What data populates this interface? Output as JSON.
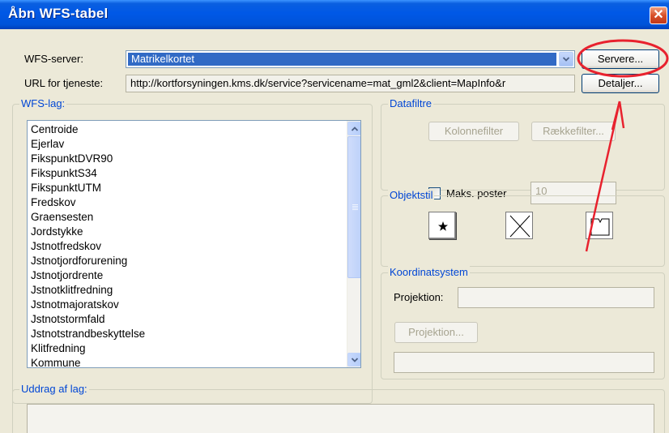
{
  "window": {
    "title": "Åbn WFS-tabel",
    "close_glyph": "✕"
  },
  "server": {
    "label": "WFS-server:",
    "selected": "Matrikelkortet",
    "servers_button": "Servere..."
  },
  "url": {
    "label": "URL for tjeneste:",
    "value": "http://kortforsyningen.kms.dk/service?servicename=mat_gml2&client=MapInfo&r",
    "details_button": "Detaljer..."
  },
  "layers": {
    "legend": "WFS-lag:",
    "items": [
      "Centroide",
      "Ejerlav",
      "FikspunktDVR90",
      "FikspunktS34",
      "FikspunktUTM",
      "Fredskov",
      "Graensesten",
      "Jordstykke",
      "Jstnotfredskov",
      "Jstnotjordforurening",
      "Jstnotjordrente",
      "Jstnotklitfredning",
      "Jstnotmajoratskov",
      "Jstnotstormfald",
      "Jstnotstrandbeskyttelse",
      "Klitfredning",
      "Kommune"
    ]
  },
  "filters": {
    "legend": "Datafiltre",
    "column_filter": "Kolonnefilter",
    "row_filter": "Rækkefilter...",
    "max_records_label": "Maks. poster",
    "max_records_value": "10",
    "max_records_checked": false
  },
  "object_style": {
    "legend": "Objektstil",
    "symbol_icon": "star-symbol-icon",
    "line_icon": "cross-line-icon",
    "region_icon": "region-shape-icon"
  },
  "coordsys": {
    "legend": "Koordinatsystem",
    "projection_label": "Projektion:",
    "projection_value": "",
    "projection_button": "Projektion...",
    "projection_name": ""
  },
  "extract": {
    "legend": "Uddrag af lag:"
  },
  "annotation": {
    "color": "#e8222e",
    "description": "red-ellipse-and-arrow"
  }
}
